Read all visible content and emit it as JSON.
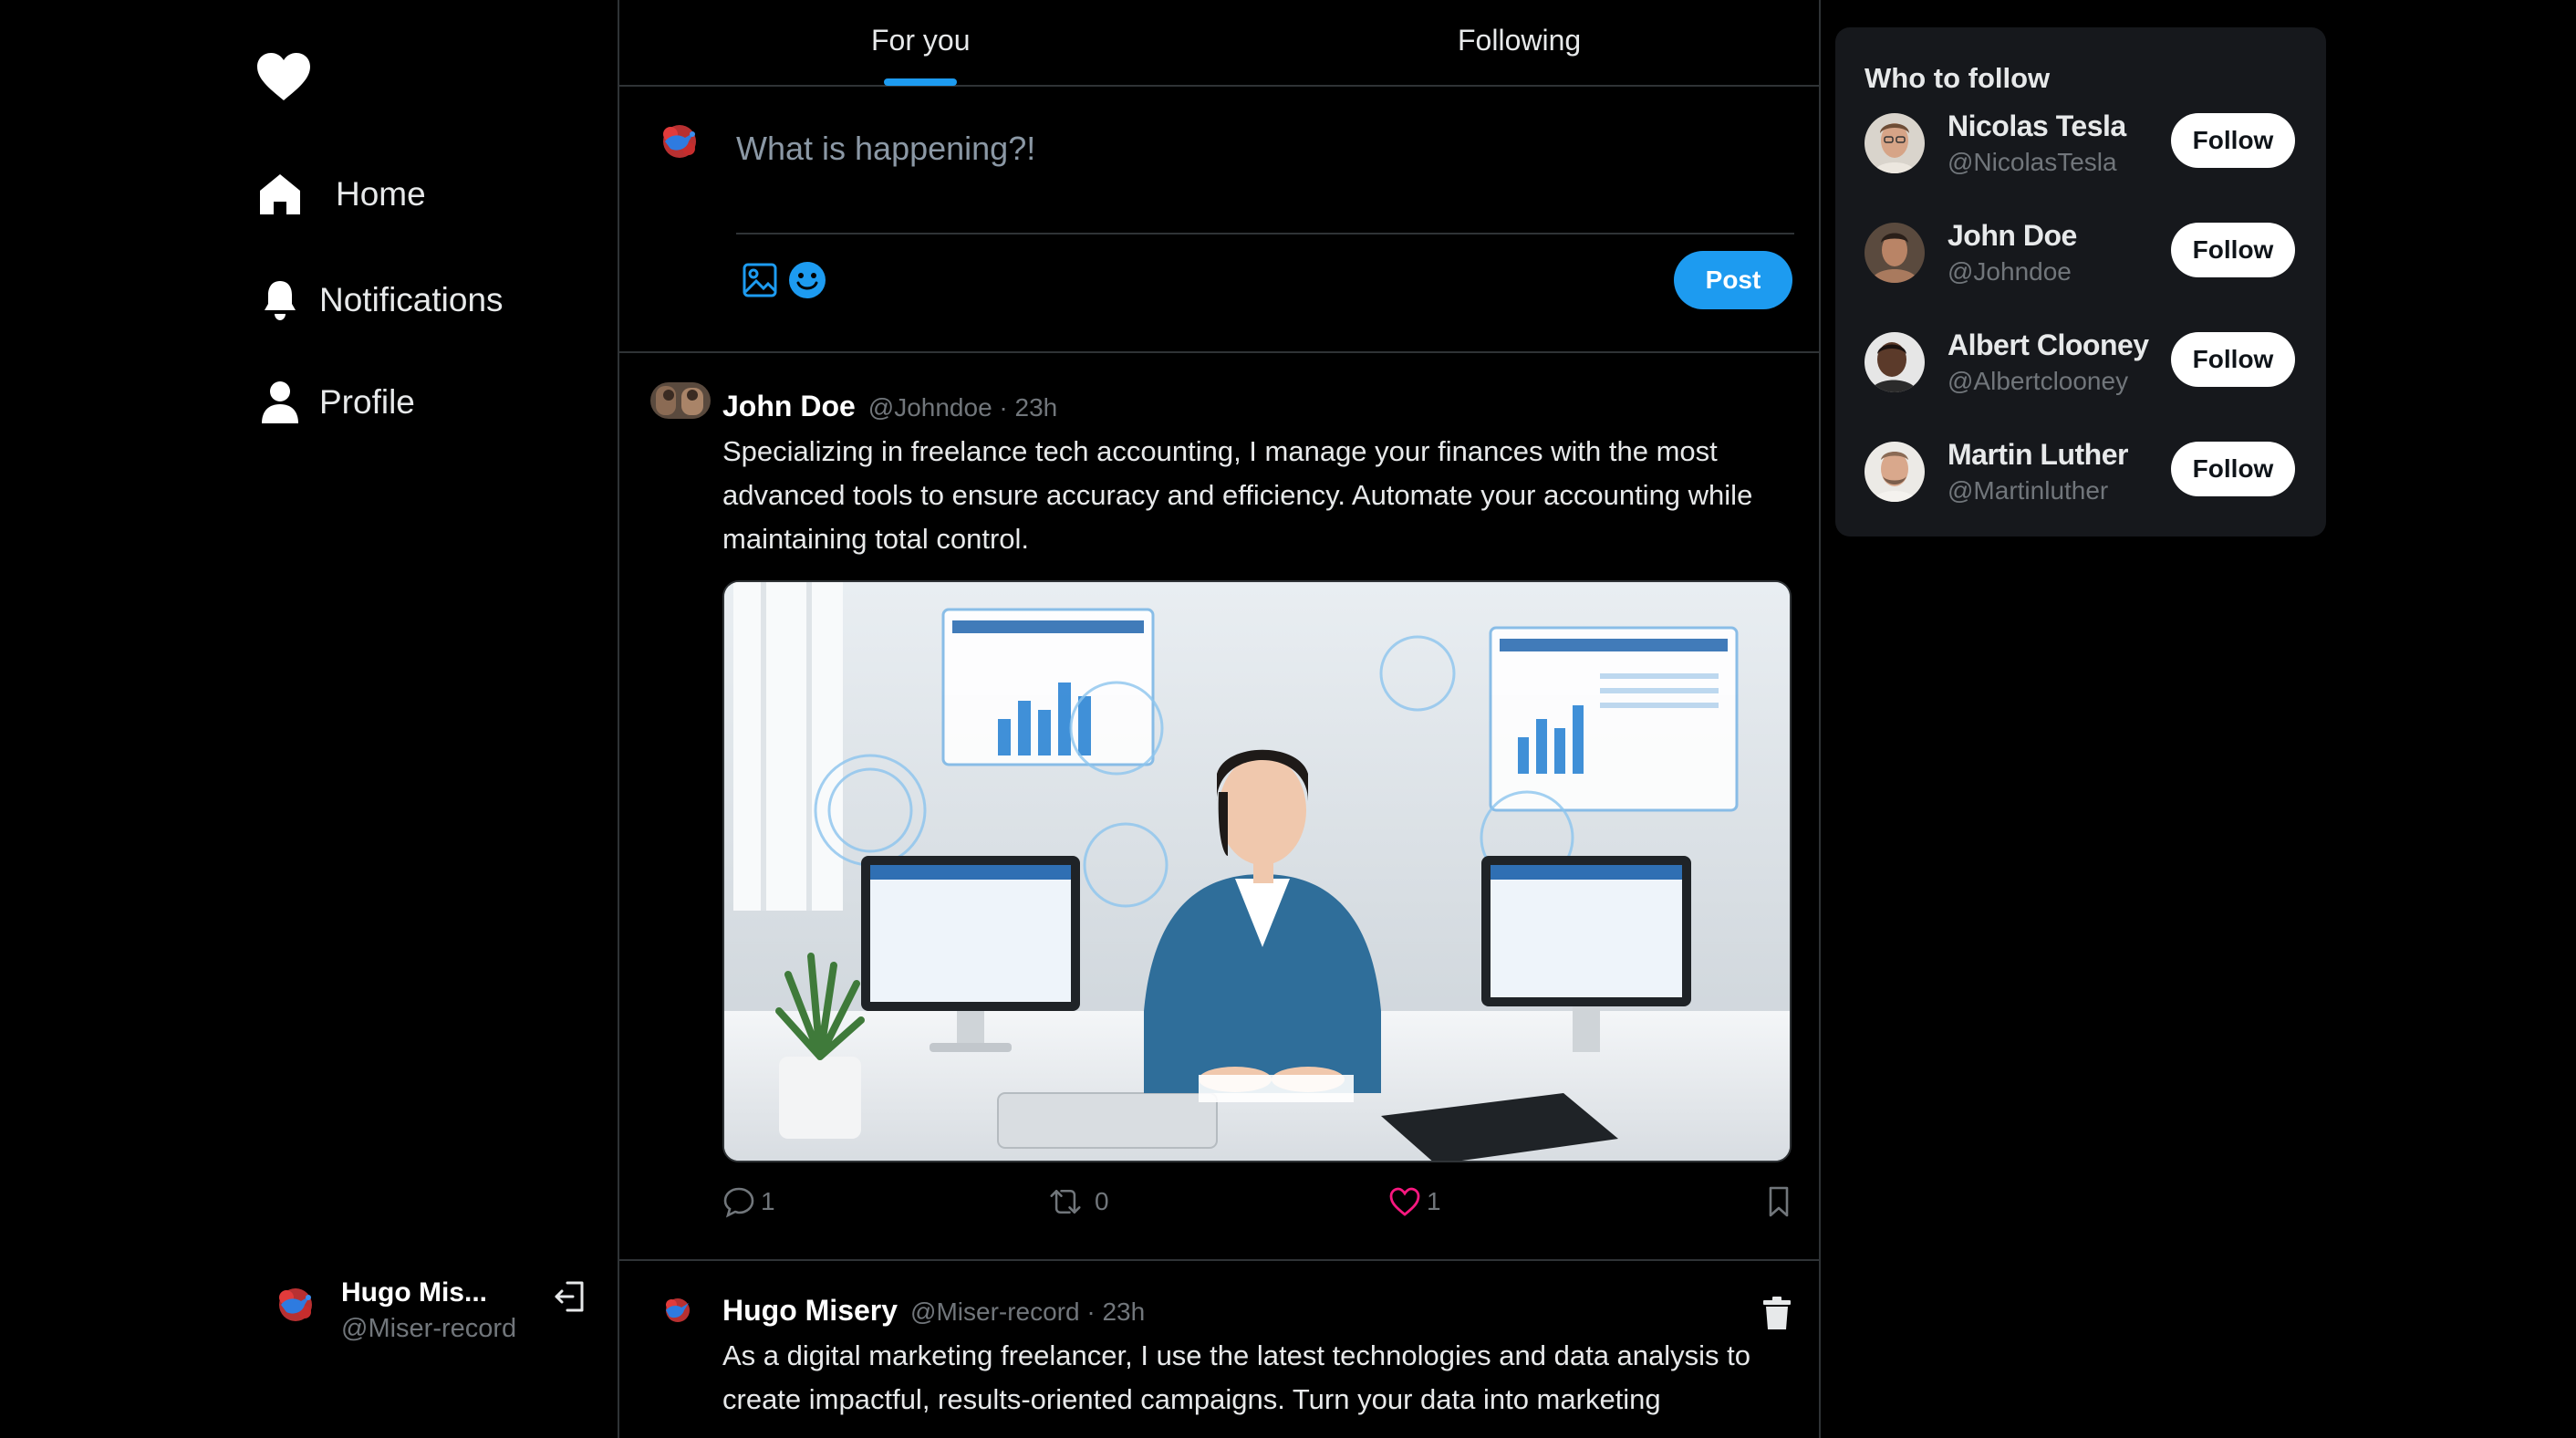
{
  "sidebar": {
    "logo_icon": "heart-icon",
    "nav": [
      {
        "label": "Home",
        "icon": "home-icon"
      },
      {
        "label": "Notifications",
        "icon": "bell-icon"
      },
      {
        "label": "Profile",
        "icon": "user-icon"
      }
    ],
    "account": {
      "name": "Hugo Mis...",
      "handle": "@Miser-record",
      "logout_icon": "logout-icon"
    }
  },
  "tabs": {
    "for_you": "For you",
    "following": "Following",
    "active": "For you"
  },
  "composer": {
    "placeholder": "What is happening?!",
    "value": "",
    "post_label": "Post",
    "accent": "#1d9bf0"
  },
  "feed": [
    {
      "name": "John Doe",
      "handle": "@Johndoe",
      "time": "23h",
      "meta": "@Johndoe · 23h",
      "text": "Specializing in freelance tech accounting, I manage your finances with the most advanced tools to ensure accuracy and efficiency. Automate your accounting while maintaining total control.",
      "has_image": true,
      "image_subject": "accountant-with-holographic-dashboards",
      "stats": {
        "replies": "1",
        "retweets": "0",
        "likes": "1"
      }
    },
    {
      "name": "Hugo Misery",
      "handle": "@Miser-record",
      "time": "23h",
      "meta": "@Miser-record · 23h",
      "text": "As a digital marketing freelancer, I use the latest technologies and data analysis to create impactful, results-oriented campaigns. Turn your data into marketing",
      "has_delete": true
    }
  ],
  "who_to_follow": {
    "title": "Who to follow",
    "users": [
      {
        "name": "Nicolas Tesla",
        "handle": "@NicolasTesla",
        "button": "Follow"
      },
      {
        "name": "John Doe",
        "handle": "@Johndoe",
        "button": "Follow"
      },
      {
        "name": "Albert Clooney",
        "handle": "@Albertclooney",
        "button": "Follow"
      },
      {
        "name": "Martin Luther",
        "handle": "@Martinluther",
        "button": "Follow"
      }
    ]
  },
  "colors": {
    "background": "#000000",
    "border": "#2f3336",
    "accent": "#1d9bf0",
    "muted": "#71767b",
    "like": "#f91880"
  }
}
